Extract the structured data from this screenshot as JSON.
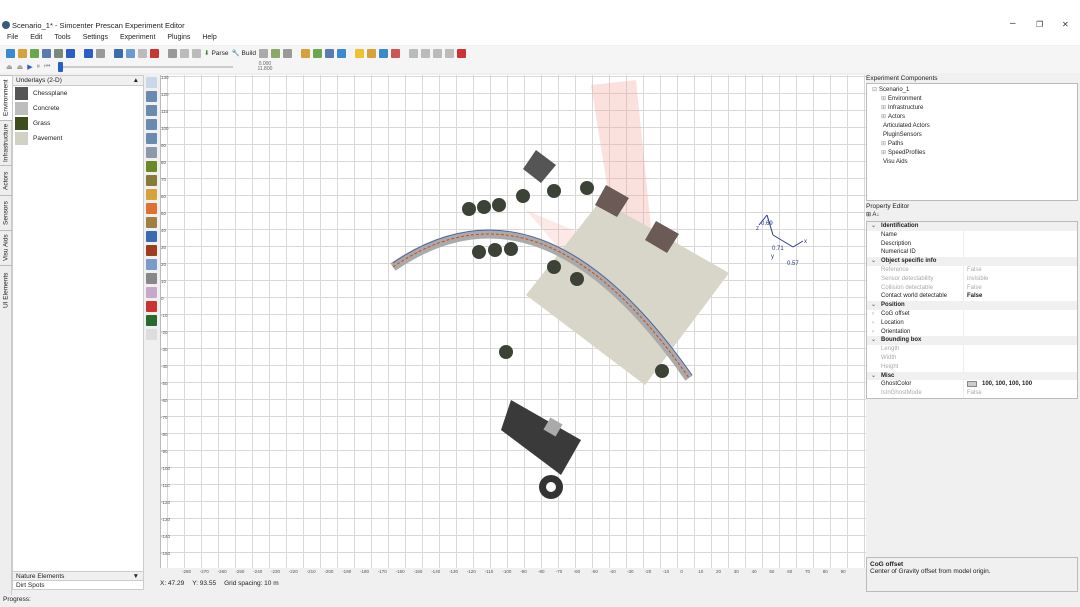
{
  "window": {
    "title": "Scenario_1* - Simcenter Prescan Experiment Editor",
    "minimize": "–",
    "maximize": "❐",
    "close": "✕"
  },
  "menu": [
    "File",
    "Edit",
    "Tools",
    "Settings",
    "Experiment",
    "Plugins",
    "Help"
  ],
  "toolbar": {
    "parse": "Parse",
    "build": "Build",
    "slider_value": "0.000",
    "slider_total": "11.800",
    "slider_fraction": 0
  },
  "left_tabs": [
    "Environment",
    "Infrastructure",
    "Actors",
    "Sensors",
    "Visu Aids",
    "UI Elements"
  ],
  "left_panel": {
    "header": "Underlays (2-D)",
    "items": [
      {
        "label": "Chessplane",
        "color": "#555555"
      },
      {
        "label": "Concrete",
        "color": "#bdbdbd"
      },
      {
        "label": "Grass",
        "color": "#3d4d1c"
      },
      {
        "label": "Pavement",
        "color": "#d2d2c4"
      }
    ],
    "bottom_dropdown": "Nature Elements",
    "bottom_item": "Dirt Spots"
  },
  "axes": {
    "y": [
      "130",
      "120",
      "110",
      "100",
      "90",
      "80",
      "70",
      "60",
      "50",
      "40",
      "30",
      "20",
      "10",
      "0",
      "-10",
      "-20",
      "-30",
      "-40",
      "-50",
      "-60",
      "-70",
      "-80",
      "-90",
      "-100",
      "-110",
      "-120",
      "-130",
      "-140",
      "-150"
    ],
    "x": [
      "-280",
      "-270",
      "-260",
      "-250",
      "-240",
      "-230",
      "-220",
      "-210",
      "-200",
      "-190",
      "-180",
      "-170",
      "-160",
      "-150",
      "-140",
      "-130",
      "-120",
      "-110",
      "-100",
      "-90",
      "-80",
      "-70",
      "-60",
      "-50",
      "-40",
      "-30",
      "-20",
      "-10",
      "0",
      "10",
      "20",
      "30",
      "40",
      "50",
      "60",
      "70",
      "80",
      "90"
    ]
  },
  "scene": {
    "gizmo_labels": [
      "0.69",
      "0.71",
      "0.57",
      "x",
      "y",
      "z"
    ]
  },
  "status": {
    "x": "X: 47.29",
    "y": "Y: 93.55",
    "grid": "Grid spacing: 10 m",
    "progress": "Progress:"
  },
  "experiment_components": {
    "title": "Experiment Components",
    "tree": [
      {
        "label": "Scenario_1",
        "level": 0,
        "exp": "⊟"
      },
      {
        "label": "Environment",
        "level": 1,
        "exp": "⊞"
      },
      {
        "label": "Infrastructure",
        "level": 1,
        "exp": "⊞"
      },
      {
        "label": "Actors",
        "level": 1,
        "exp": "⊞"
      },
      {
        "label": "Articulated Actors",
        "level": 1,
        "exp": ""
      },
      {
        "label": "PluginSensors",
        "level": 1,
        "exp": ""
      },
      {
        "label": "Paths",
        "level": 1,
        "exp": "⊞"
      },
      {
        "label": "SpeedProfiles",
        "level": 1,
        "exp": "⊞"
      },
      {
        "label": "Visu Aids",
        "level": 1,
        "exp": ""
      }
    ]
  },
  "property_editor": {
    "title": "Property Editor",
    "toolbar": "⊞ A↓",
    "rows": [
      {
        "cat": "Identification"
      },
      {
        "k": "Name",
        "v": ""
      },
      {
        "k": "Description",
        "v": ""
      },
      {
        "k": "Numerical ID",
        "v": ""
      },
      {
        "cat": "Object specific info"
      },
      {
        "k": "Reference",
        "v": "False",
        "dim": true
      },
      {
        "k": "Sensor detectability",
        "v": "invisible",
        "dim": true
      },
      {
        "k": "Collision detectable",
        "v": "False",
        "dim": true
      },
      {
        "k": "Contact world detectable",
        "v": "False",
        "bold": true
      },
      {
        "cat": "Position"
      },
      {
        "k": "CoG offset",
        "v": "",
        "exp": true
      },
      {
        "k": "Location",
        "v": "",
        "exp": true
      },
      {
        "k": "Orientation",
        "v": "",
        "exp": true
      },
      {
        "cat": "Bounding box"
      },
      {
        "k": "Length",
        "v": "",
        "dim": true
      },
      {
        "k": "Width",
        "v": "",
        "dim": true
      },
      {
        "k": "Height",
        "v": "",
        "dim": true
      },
      {
        "cat": "Misc"
      },
      {
        "k": "GhostColor",
        "v": "100, 100, 100, 100",
        "swatch": true,
        "bold": true
      },
      {
        "k": "IsInGhostMode",
        "v": "False",
        "dim": true
      }
    ],
    "help_title": "CoG offset",
    "help_text": "Center of Gravity offset from model origin."
  }
}
